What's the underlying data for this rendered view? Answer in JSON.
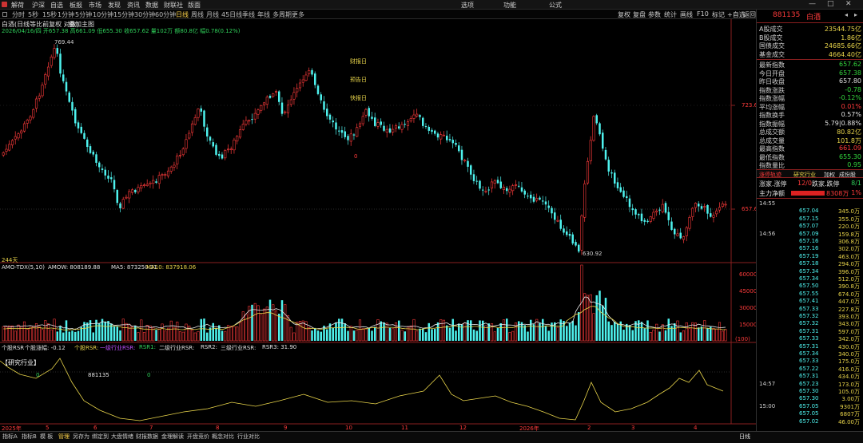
{
  "menu": {
    "items": [
      "解荷",
      "沪深",
      "自选",
      "板报",
      "市场",
      "发现",
      "资讯",
      "数据",
      "财联社",
      "版面"
    ],
    "center_items": [
      "选项",
      "功能",
      "公式"
    ]
  },
  "periods": [
    "分时",
    "5秒",
    "15秒",
    "1分钟",
    "5分钟",
    "10分钟",
    "15分钟",
    "30分钟",
    "60分钟",
    "日线",
    "周线",
    "月线",
    "45日线",
    "季线",
    "年线",
    "多周期",
    "更多"
  ],
  "active_period": "日线",
  "toolbar": [
    "复权",
    "复盘",
    "参数",
    "统计",
    "画线",
    "F10",
    "标记",
    "+自选",
    "返回"
  ],
  "chart_header": {
    "title": "白酒(日线等比前复权 对数)",
    "subtitle": "叠加主图",
    "ohlc_line": "2026/04/16/四 开657.38 高661.09 低655.30 收657.62 量102万 额80.8亿 幅0.78(0.12%)"
  },
  "annotations": {
    "high_label": "769.44",
    "low_label": "630.92",
    "price_723": "723.6",
    "price_657": "657.6",
    "event_1": "财报日",
    "event_2": "预告日",
    "event_3": "快报日",
    "marker_zero": "0",
    "days": "244天"
  },
  "volume_header": {
    "label": "AMO-TDX(5,10)",
    "amow": "AMOW: 808189.88",
    "ma5": "MA5: 873250.31",
    "ma10": "MA10: 837918.06"
  },
  "volume_axis": [
    "60000",
    "45000",
    "30000",
    "15000",
    "(100)"
  ],
  "rsr_header": {
    "title": "个股RSR",
    "hint": "个股涨幅: -0.12",
    "rsr_label": "个股RSR:",
    "ind1": "一级行业RSR:",
    "rsr1": "RSR1:",
    "ind2": "二级行业RSR:",
    "rsr2": "RSR2:",
    "ind3": "三级行业RSR:",
    "rsr3": "RSR3: 31.90"
  },
  "rsr_panel": {
    "tag": "【研究行业】",
    "code_label": "881135",
    "zero_1": "0",
    "zero_2": "0"
  },
  "x_axis": [
    "2025年",
    "5",
    "6",
    "7",
    "8",
    "9",
    "10",
    "11",
    "12",
    "2026年",
    "2",
    "3",
    "4"
  ],
  "bottom_tabs": [
    "指标A",
    "指标B",
    "模 板",
    "管理",
    "另存为",
    "绑定到",
    "大盘情绪",
    "财报数据",
    "金理解读",
    "开盘竞价",
    "概念对比",
    "行业对比"
  ],
  "active_bottom_tab": "管理",
  "bottom_right": "日线",
  "right_panel": {
    "code": "881135",
    "name": "白酒",
    "top_rows": [
      {
        "label": "A股成交",
        "value": "23544.75亿",
        "color": "#e8d44a"
      },
      {
        "label": "B股成交",
        "value": "1.86亿",
        "color": "#e8d44a"
      },
      {
        "label": "国债成交",
        "value": "24685.66亿",
        "color": "#e8d44a"
      },
      {
        "label": "基金成交",
        "value": "4664.40亿",
        "color": "#e8d44a"
      }
    ],
    "stats": [
      {
        "label": "最新指数",
        "value": "657.62",
        "color": "#32d23c"
      },
      {
        "label": "今日开盘",
        "value": "657.38",
        "color": "#32d23c"
      },
      {
        "label": "昨日收盘",
        "value": "657.80",
        "color": "#e0e0e0"
      },
      {
        "label": "指数涨跌",
        "value": "-0.78",
        "color": "#32d23c"
      },
      {
        "label": "指数涨幅",
        "value": "-0.12%",
        "color": "#32d23c"
      },
      {
        "label": "平均涨幅",
        "value": "0.01%",
        "color": "#ff3b3b"
      },
      {
        "label": "指数换手",
        "value": "0.57%",
        "color": "#e0e0e0"
      },
      {
        "label": "指数振幅",
        "value": "5.79|0.88%",
        "color": "#e0e0e0"
      },
      {
        "label": "总成交额",
        "value": "80.82亿",
        "color": "#e8d44a"
      },
      {
        "label": "总成交量",
        "value": "101.8万",
        "color": "#e8d44a"
      },
      {
        "label": "最高指数",
        "value": "661.09",
        "color": "#ff3b3b"
      },
      {
        "label": "最低指数",
        "value": "655.30",
        "color": "#32d23c"
      },
      {
        "label": "指数量比",
        "value": "0.95",
        "color": "#32d23c"
      }
    ],
    "tabs": {
      "t1": "涨停轨迹",
      "t2": "研究行业",
      "t3": "加权",
      "t4": "成份股"
    },
    "limit_row": {
      "label": "涨家.涨停",
      "mid": "12/0",
      "label2": "跌家.跌停",
      "right": "8/1"
    },
    "main_flow": {
      "label": "主力净额",
      "value": "8308万",
      "pct": "1%"
    },
    "ticks": [
      {
        "t": "14:55",
        "p": "",
        "v": ""
      },
      {
        "t": "",
        "p": "657.04",
        "v": "345.0万"
      },
      {
        "t": "",
        "p": "657.15",
        "v": "355.0万"
      },
      {
        "t": "",
        "p": "657.07",
        "v": "220.0万"
      },
      {
        "t": "14:56",
        "p": "657.09",
        "v": "159.8万"
      },
      {
        "t": "",
        "p": "657.16",
        "v": "306.8万"
      },
      {
        "t": "",
        "p": "657.16",
        "v": "302.0万"
      },
      {
        "t": "",
        "p": "657.19",
        "v": "463.0万"
      },
      {
        "t": "",
        "p": "657.18",
        "v": "294.0万"
      },
      {
        "t": "",
        "p": "657.34",
        "v": "396.0万"
      },
      {
        "t": "",
        "p": "657.34",
        "v": "512.0万"
      },
      {
        "t": "",
        "p": "657.50",
        "v": "390.8万"
      },
      {
        "t": "",
        "p": "657.55",
        "v": "674.0万"
      },
      {
        "t": "",
        "p": "657.41",
        "v": "447.0万"
      },
      {
        "t": "",
        "p": "657.33",
        "v": "227.8万"
      },
      {
        "t": "",
        "p": "657.32",
        "v": "393.0万"
      },
      {
        "t": "",
        "p": "657.32",
        "v": "343.0万"
      },
      {
        "t": "",
        "p": "657.31",
        "v": "597.0万"
      },
      {
        "t": "",
        "p": "657.33",
        "v": "342.0万"
      },
      {
        "t": "",
        "p": "657.31",
        "v": "430.0万"
      },
      {
        "t": "",
        "p": "657.34",
        "v": "340.0万"
      },
      {
        "t": "",
        "p": "657.33",
        "v": "175.0万"
      },
      {
        "t": "",
        "p": "657.22",
        "v": "416.0万"
      },
      {
        "t": "",
        "p": "657.31",
        "v": "434.0万"
      },
      {
        "t": "14:57",
        "p": "657.23",
        "v": "173.0万"
      },
      {
        "t": "",
        "p": "657.30",
        "v": "105.0万"
      },
      {
        "t": "",
        "p": "657.30",
        "v": "3.00万"
      },
      {
        "t": "15:00",
        "p": "657.05",
        "v": "9301万"
      },
      {
        "t": "",
        "p": "657.05",
        "v": "6807万"
      },
      {
        "t": "",
        "p": "657.02",
        "v": "46.00万"
      }
    ]
  }
}
